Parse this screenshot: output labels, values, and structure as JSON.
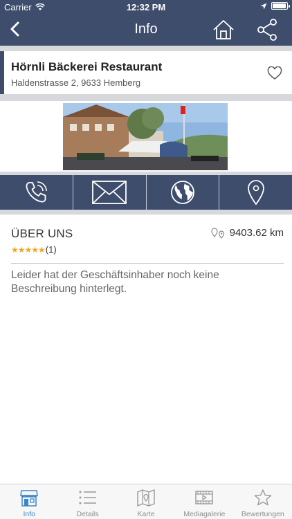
{
  "status_bar": {
    "carrier": "Carrier",
    "time": "12:32 PM"
  },
  "nav": {
    "title": "Info",
    "back_icon": "chevron-left-icon",
    "home_icon": "home-icon",
    "share_icon": "share-icon"
  },
  "business": {
    "name": "Hörnli Bäckerei Restaurant",
    "address": "Haldenstrasse 2, 9633 Hemberg"
  },
  "actions": [
    {
      "icon": "phone-icon"
    },
    {
      "icon": "mail-icon"
    },
    {
      "icon": "globe-icon"
    },
    {
      "icon": "location-pin-icon"
    }
  ],
  "about": {
    "title": "ÜBER UNS",
    "distance": "9403.62 km",
    "stars": "★★★★★",
    "rating_count": "(1)",
    "description": "Leider hat der Geschäftsinhaber noch keine Beschreibung hinterlegt."
  },
  "tabs": [
    {
      "label": "Info",
      "icon": "store-icon",
      "active": true
    },
    {
      "label": "Details",
      "icon": "list-icon",
      "active": false
    },
    {
      "label": "Karte",
      "icon": "map-icon",
      "active": false
    },
    {
      "label": "Mediagalerie",
      "icon": "video-icon",
      "active": false
    },
    {
      "label": "Bewertungen",
      "icon": "star-icon",
      "active": false
    }
  ],
  "colors": {
    "primary": "#3e4d6c",
    "accent": "#3b86c9",
    "star": "#f5a623"
  }
}
